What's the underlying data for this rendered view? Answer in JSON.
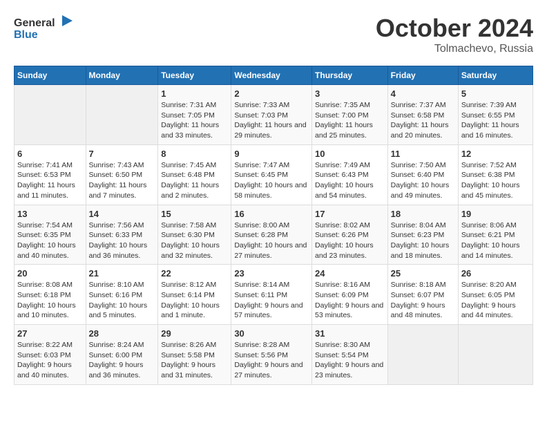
{
  "header": {
    "logo_general": "General",
    "logo_blue": "Blue",
    "main_title": "October 2024",
    "subtitle": "Tolmachevo, Russia"
  },
  "weekdays": [
    "Sunday",
    "Monday",
    "Tuesday",
    "Wednesday",
    "Thursday",
    "Friday",
    "Saturday"
  ],
  "weeks": [
    [
      {
        "day": "",
        "sunrise": "",
        "sunset": "",
        "daylight": "",
        "empty": true
      },
      {
        "day": "",
        "sunrise": "",
        "sunset": "",
        "daylight": "",
        "empty": true
      },
      {
        "day": "1",
        "sunrise": "Sunrise: 7:31 AM",
        "sunset": "Sunset: 7:05 PM",
        "daylight": "Daylight: 11 hours and 33 minutes."
      },
      {
        "day": "2",
        "sunrise": "Sunrise: 7:33 AM",
        "sunset": "Sunset: 7:03 PM",
        "daylight": "Daylight: 11 hours and 29 minutes."
      },
      {
        "day": "3",
        "sunrise": "Sunrise: 7:35 AM",
        "sunset": "Sunset: 7:00 PM",
        "daylight": "Daylight: 11 hours and 25 minutes."
      },
      {
        "day": "4",
        "sunrise": "Sunrise: 7:37 AM",
        "sunset": "Sunset: 6:58 PM",
        "daylight": "Daylight: 11 hours and 20 minutes."
      },
      {
        "day": "5",
        "sunrise": "Sunrise: 7:39 AM",
        "sunset": "Sunset: 6:55 PM",
        "daylight": "Daylight: 11 hours and 16 minutes."
      }
    ],
    [
      {
        "day": "6",
        "sunrise": "Sunrise: 7:41 AM",
        "sunset": "Sunset: 6:53 PM",
        "daylight": "Daylight: 11 hours and 11 minutes."
      },
      {
        "day": "7",
        "sunrise": "Sunrise: 7:43 AM",
        "sunset": "Sunset: 6:50 PM",
        "daylight": "Daylight: 11 hours and 7 minutes."
      },
      {
        "day": "8",
        "sunrise": "Sunrise: 7:45 AM",
        "sunset": "Sunset: 6:48 PM",
        "daylight": "Daylight: 11 hours and 2 minutes."
      },
      {
        "day": "9",
        "sunrise": "Sunrise: 7:47 AM",
        "sunset": "Sunset: 6:45 PM",
        "daylight": "Daylight: 10 hours and 58 minutes."
      },
      {
        "day": "10",
        "sunrise": "Sunrise: 7:49 AM",
        "sunset": "Sunset: 6:43 PM",
        "daylight": "Daylight: 10 hours and 54 minutes."
      },
      {
        "day": "11",
        "sunrise": "Sunrise: 7:50 AM",
        "sunset": "Sunset: 6:40 PM",
        "daylight": "Daylight: 10 hours and 49 minutes."
      },
      {
        "day": "12",
        "sunrise": "Sunrise: 7:52 AM",
        "sunset": "Sunset: 6:38 PM",
        "daylight": "Daylight: 10 hours and 45 minutes."
      }
    ],
    [
      {
        "day": "13",
        "sunrise": "Sunrise: 7:54 AM",
        "sunset": "Sunset: 6:35 PM",
        "daylight": "Daylight: 10 hours and 40 minutes."
      },
      {
        "day": "14",
        "sunrise": "Sunrise: 7:56 AM",
        "sunset": "Sunset: 6:33 PM",
        "daylight": "Daylight: 10 hours and 36 minutes."
      },
      {
        "day": "15",
        "sunrise": "Sunrise: 7:58 AM",
        "sunset": "Sunset: 6:30 PM",
        "daylight": "Daylight: 10 hours and 32 minutes."
      },
      {
        "day": "16",
        "sunrise": "Sunrise: 8:00 AM",
        "sunset": "Sunset: 6:28 PM",
        "daylight": "Daylight: 10 hours and 27 minutes."
      },
      {
        "day": "17",
        "sunrise": "Sunrise: 8:02 AM",
        "sunset": "Sunset: 6:26 PM",
        "daylight": "Daylight: 10 hours and 23 minutes."
      },
      {
        "day": "18",
        "sunrise": "Sunrise: 8:04 AM",
        "sunset": "Sunset: 6:23 PM",
        "daylight": "Daylight: 10 hours and 18 minutes."
      },
      {
        "day": "19",
        "sunrise": "Sunrise: 8:06 AM",
        "sunset": "Sunset: 6:21 PM",
        "daylight": "Daylight: 10 hours and 14 minutes."
      }
    ],
    [
      {
        "day": "20",
        "sunrise": "Sunrise: 8:08 AM",
        "sunset": "Sunset: 6:18 PM",
        "daylight": "Daylight: 10 hours and 10 minutes."
      },
      {
        "day": "21",
        "sunrise": "Sunrise: 8:10 AM",
        "sunset": "Sunset: 6:16 PM",
        "daylight": "Daylight: 10 hours and 5 minutes."
      },
      {
        "day": "22",
        "sunrise": "Sunrise: 8:12 AM",
        "sunset": "Sunset: 6:14 PM",
        "daylight": "Daylight: 10 hours and 1 minute."
      },
      {
        "day": "23",
        "sunrise": "Sunrise: 8:14 AM",
        "sunset": "Sunset: 6:11 PM",
        "daylight": "Daylight: 9 hours and 57 minutes."
      },
      {
        "day": "24",
        "sunrise": "Sunrise: 8:16 AM",
        "sunset": "Sunset: 6:09 PM",
        "daylight": "Daylight: 9 hours and 53 minutes."
      },
      {
        "day": "25",
        "sunrise": "Sunrise: 8:18 AM",
        "sunset": "Sunset: 6:07 PM",
        "daylight": "Daylight: 9 hours and 48 minutes."
      },
      {
        "day": "26",
        "sunrise": "Sunrise: 8:20 AM",
        "sunset": "Sunset: 6:05 PM",
        "daylight": "Daylight: 9 hours and 44 minutes."
      }
    ],
    [
      {
        "day": "27",
        "sunrise": "Sunrise: 8:22 AM",
        "sunset": "Sunset: 6:03 PM",
        "daylight": "Daylight: 9 hours and 40 minutes."
      },
      {
        "day": "28",
        "sunrise": "Sunrise: 8:24 AM",
        "sunset": "Sunset: 6:00 PM",
        "daylight": "Daylight: 9 hours and 36 minutes."
      },
      {
        "day": "29",
        "sunrise": "Sunrise: 8:26 AM",
        "sunset": "Sunset: 5:58 PM",
        "daylight": "Daylight: 9 hours and 31 minutes."
      },
      {
        "day": "30",
        "sunrise": "Sunrise: 8:28 AM",
        "sunset": "Sunset: 5:56 PM",
        "daylight": "Daylight: 9 hours and 27 minutes."
      },
      {
        "day": "31",
        "sunrise": "Sunrise: 8:30 AM",
        "sunset": "Sunset: 5:54 PM",
        "daylight": "Daylight: 9 hours and 23 minutes."
      },
      {
        "day": "",
        "sunrise": "",
        "sunset": "",
        "daylight": "",
        "empty": true
      },
      {
        "day": "",
        "sunrise": "",
        "sunset": "",
        "daylight": "",
        "empty": true
      }
    ]
  ]
}
